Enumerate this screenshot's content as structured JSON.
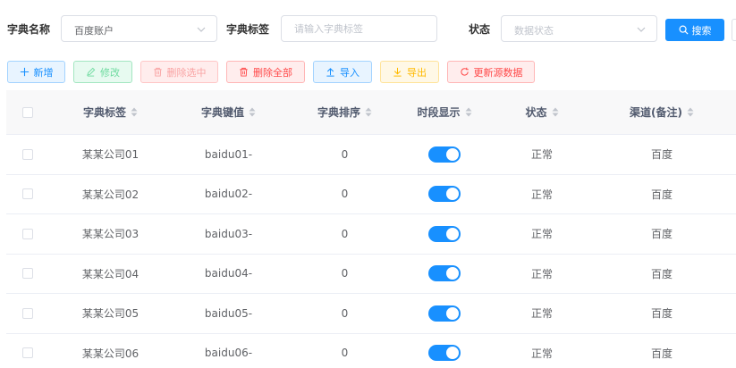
{
  "filters": {
    "dict_name": {
      "label": "字典名称",
      "value": "百度账户"
    },
    "dict_label": {
      "label": "字典标签",
      "placeholder": "请输入字典标签"
    },
    "status": {
      "label": "状态",
      "placeholder": "数据状态"
    },
    "search_button": "搜索"
  },
  "toolbar": {
    "add": "新增",
    "edit": "修改",
    "delete_selected": "删除选中",
    "delete_all": "删除全部",
    "import": "导入",
    "export": "导出",
    "refresh_source": "更新源数据"
  },
  "table": {
    "columns": [
      "字典标签",
      "字典键值",
      "字典排序",
      "时段显示",
      "状态",
      "渠道(备注)"
    ],
    "rows": [
      {
        "label": "某某公司01",
        "key": "baidu01-",
        "sort": "0",
        "show": true,
        "status": "正常",
        "channel": "百度"
      },
      {
        "label": "某某公司02",
        "key": "baidu02-",
        "sort": "0",
        "show": true,
        "status": "正常",
        "channel": "百度"
      },
      {
        "label": "某某公司03",
        "key": "baidu03-",
        "sort": "0",
        "show": true,
        "status": "正常",
        "channel": "百度"
      },
      {
        "label": "某某公司04",
        "key": "baidu04-",
        "sort": "0",
        "show": true,
        "status": "正常",
        "channel": "百度"
      },
      {
        "label": "某某公司05",
        "key": "baidu05-",
        "sort": "0",
        "show": true,
        "status": "正常",
        "channel": "百度"
      },
      {
        "label": "某某公司06",
        "key": "baidu06-",
        "sort": "0",
        "show": true,
        "status": "正常",
        "channel": "百度"
      }
    ]
  },
  "colors": {
    "primary": "#1890ff",
    "success": "#13ce66",
    "danger": "#ff4949",
    "warning": "#ffba00",
    "header_bg": "#f8f8f9"
  },
  "icons": {
    "add": "plus-icon",
    "edit": "pencil-icon",
    "delete": "trash-icon",
    "import": "upload-icon",
    "export": "download-icon",
    "refresh": "refresh-icon",
    "search": "search-icon",
    "dropdown": "chevron-down-icon",
    "sort": "sort-caret-icon"
  }
}
